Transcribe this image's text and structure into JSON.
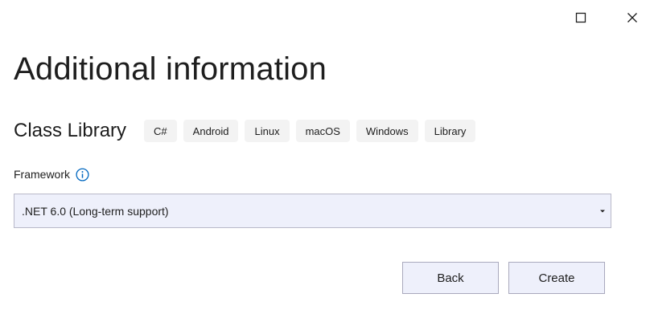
{
  "window": {
    "maximize_icon": "maximize-icon",
    "close_icon": "close-icon"
  },
  "heading": "Additional information",
  "template": {
    "name": "Class Library",
    "tags": [
      "C#",
      "Android",
      "Linux",
      "macOS",
      "Windows",
      "Library"
    ]
  },
  "framework": {
    "label": "Framework",
    "info_icon": "info-icon",
    "selected": ".NET 6.0 (Long-term support)"
  },
  "buttons": {
    "back": "Back",
    "create": "Create"
  },
  "colors": {
    "accent": "#0067c0",
    "control_background": "#eef0fb",
    "control_border": "#b9b9c9",
    "tag_background": "#f3f3f3"
  }
}
